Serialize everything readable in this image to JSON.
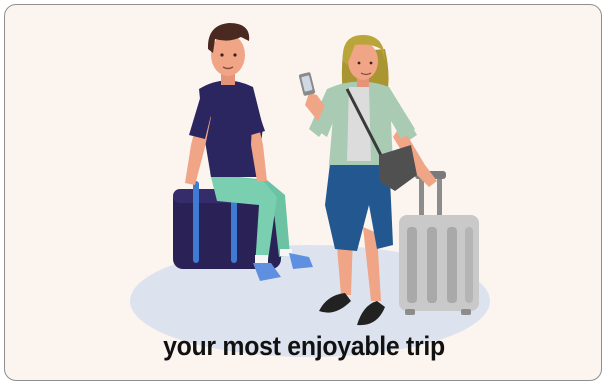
{
  "caption": "your most enjoyable trip",
  "colors": {
    "background": "#fcf4ef",
    "border": "#8f8f8f",
    "ground_shadow": "#dde3ee",
    "duffel_bag": "#2a2257",
    "duffel_strap": "#3f7bd3",
    "man_shirt": "#2c2660",
    "man_pants": "#79cfaf",
    "skin": "#f0a587",
    "woman_hair": "#b9a53a",
    "woman_jacket": "#a9cbb4",
    "woman_jeans": "#22578f",
    "crossbody_bag": "#505050",
    "suitcase": "#c9c9c9",
    "text": "#111111"
  },
  "icons": [
    "travel-illustration"
  ]
}
